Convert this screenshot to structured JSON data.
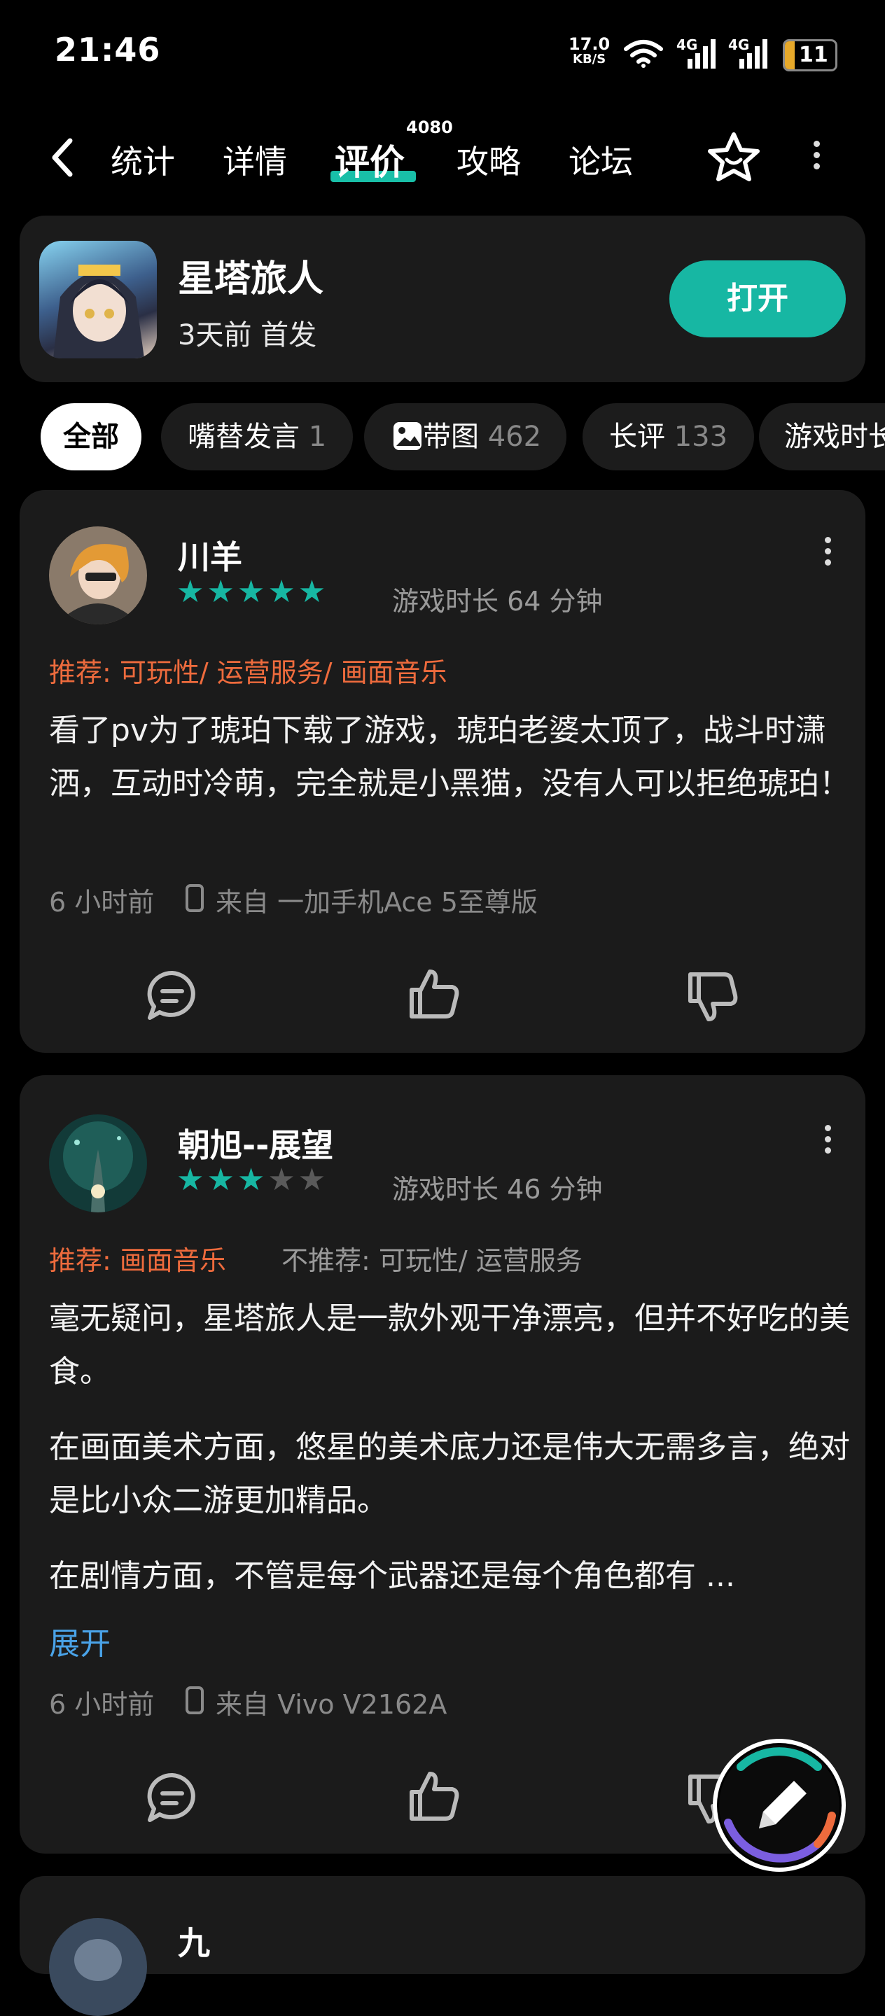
{
  "status_bar": {
    "time": "21:46",
    "net_speed": "17.0",
    "net_unit": "KB/S",
    "sig1": "4G",
    "sig2": "4G",
    "battery": "11"
  },
  "nav": {
    "tabs": [
      "统计",
      "详情",
      "评价",
      "攻略",
      "论坛"
    ],
    "active_tab": "评价",
    "review_count": "4080"
  },
  "app": {
    "name": "星塔旅人",
    "subtitle": "3天前 首发",
    "open_label": "打开"
  },
  "filters": [
    {
      "label": "全部",
      "count": ""
    },
    {
      "label": "嘴替发言",
      "count": "1"
    },
    {
      "label": "带图",
      "count": "462"
    },
    {
      "label": "长评",
      "count": "133"
    },
    {
      "label": "游戏时长",
      "count": ""
    }
  ],
  "reviews": [
    {
      "user": "川羊",
      "rating": 5,
      "playtime": "游戏时长 64 分钟",
      "recommend": "推荐: 可玩性/ 运营服务/ 画面音乐",
      "not_recommend": "",
      "paragraphs": [
        "看了pv为了琥珀下载了游戏，琥珀老婆太顶了，战斗时潇洒，互动时冷萌，完全就是小黑猫，没有人可以拒绝琥珀！"
      ],
      "time": "6 小时前",
      "device": "来自 一加手机Ace 5至尊版"
    },
    {
      "user": "朝旭--展望",
      "rating": 3,
      "playtime": "游戏时长 46 分钟",
      "recommend": "推荐: 画面音乐",
      "not_recommend": "不推荐: 可玩性/ 运营服务",
      "paragraphs": [
        "毫无疑问，星塔旅人是一款外观干净漂亮，但并不好吃的美食。",
        "在画面美术方面，悠星的美术底力还是伟大无需多言，绝对是比小众二游更加精品。",
        "在剧情方面，不管是每个武器还是每个角色都有 ..."
      ],
      "expand_label": "展开",
      "time": "6 小时前",
      "device": "来自 Vivo V2162A"
    },
    {
      "user": "九"
    }
  ],
  "icons": {
    "back": "chevron-left-icon",
    "favorite": "star-outline-icon",
    "more": "more-vertical-icon",
    "comment": "comment-icon",
    "like": "thumb-up-icon",
    "dislike": "thumb-down-icon",
    "image": "image-icon",
    "phone": "phone-icon",
    "edit": "pencil-icon"
  },
  "colors": {
    "accent": "#17b7a3",
    "recommend": "#ee6b3d",
    "link": "#4aa3e8",
    "card": "#1b1b1b"
  }
}
